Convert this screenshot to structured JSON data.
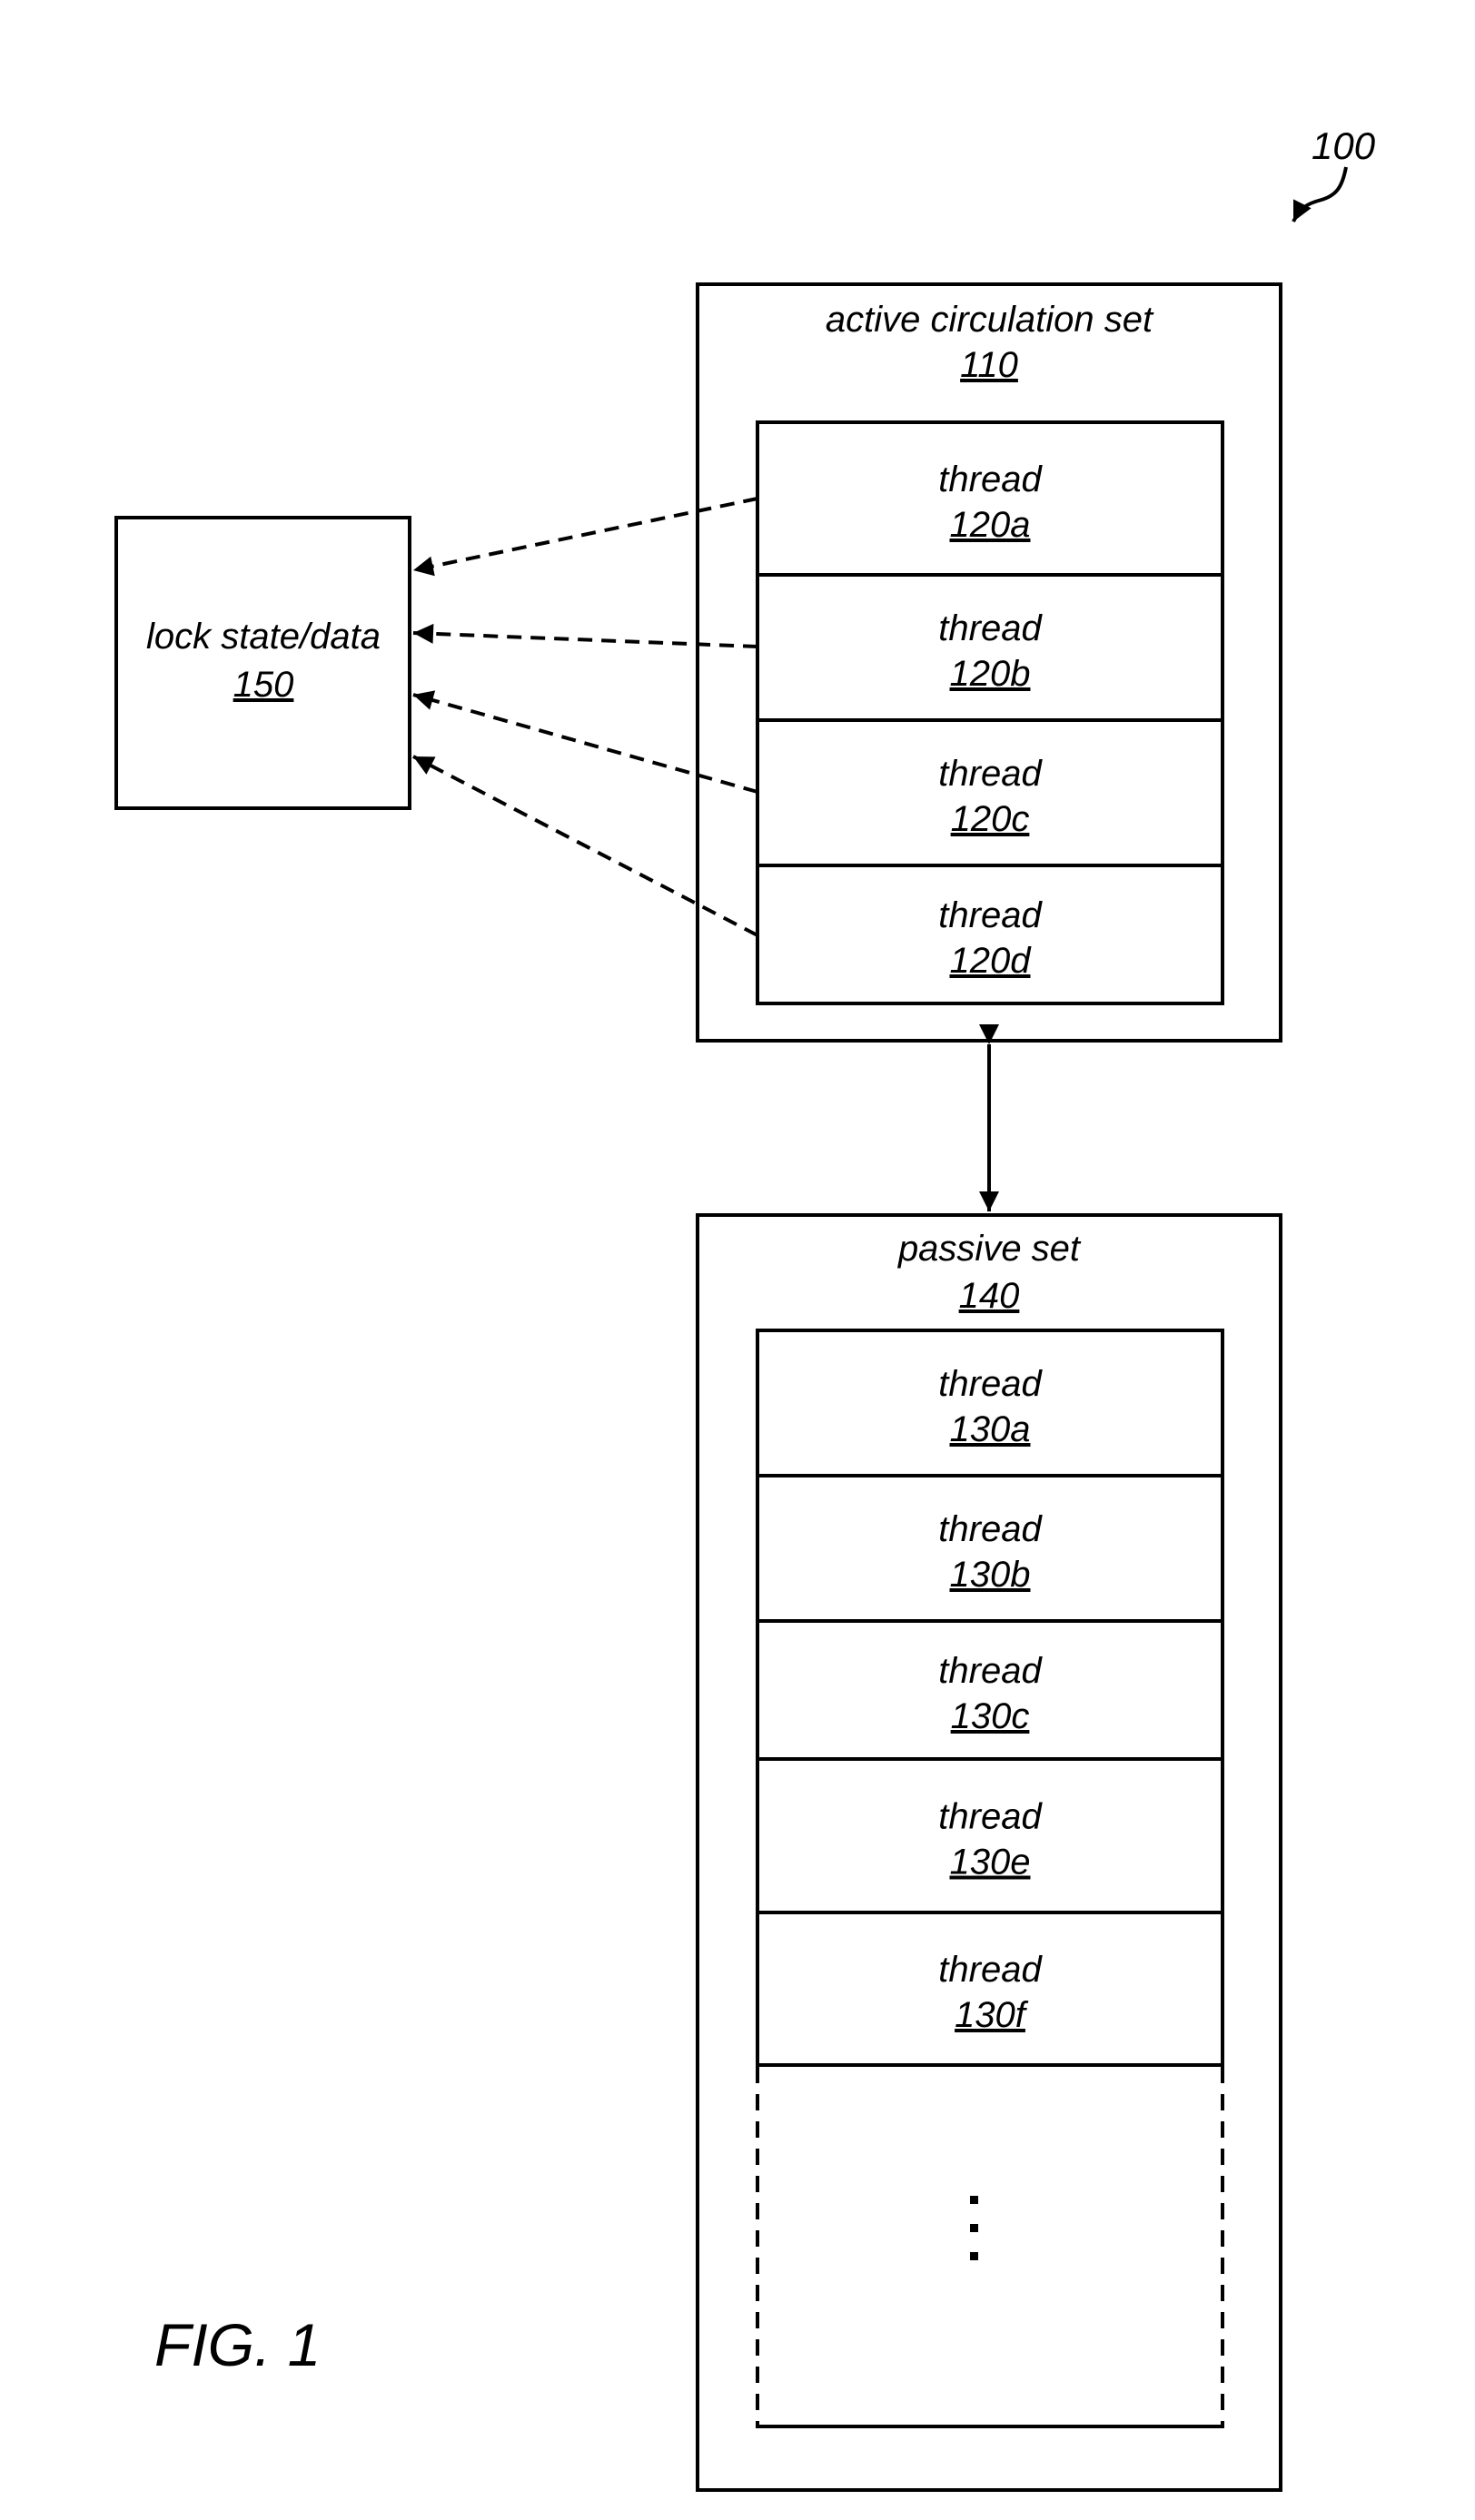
{
  "figure": {
    "label": "FIG. 1",
    "reference": "100"
  },
  "lock": {
    "title": "lock state/data",
    "ref": "150"
  },
  "active_set": {
    "title": "active circulation set",
    "ref": "110",
    "threads": [
      {
        "label": "thread",
        "ref": "120a"
      },
      {
        "label": "thread",
        "ref": "120b"
      },
      {
        "label": "thread",
        "ref": "120c"
      },
      {
        "label": "thread",
        "ref": "120d"
      }
    ]
  },
  "passive_set": {
    "title": "passive set",
    "ref": "140",
    "threads": [
      {
        "label": "thread",
        "ref": "130a"
      },
      {
        "label": "thread",
        "ref": "130b"
      },
      {
        "label": "thread",
        "ref": "130c"
      },
      {
        "label": "thread",
        "ref": "130e"
      },
      {
        "label": "thread",
        "ref": "130f"
      }
    ],
    "continuation": "⋮"
  },
  "connections": [
    {
      "from": "120a",
      "to": "150",
      "style": "dashed-arrow"
    },
    {
      "from": "120b",
      "to": "150",
      "style": "dashed-arrow"
    },
    {
      "from": "120c",
      "to": "150",
      "style": "dashed-arrow"
    },
    {
      "from": "120d",
      "to": "150",
      "style": "dashed-arrow"
    },
    {
      "from": "110",
      "to": "140",
      "style": "bidirectional-arrow"
    }
  ]
}
